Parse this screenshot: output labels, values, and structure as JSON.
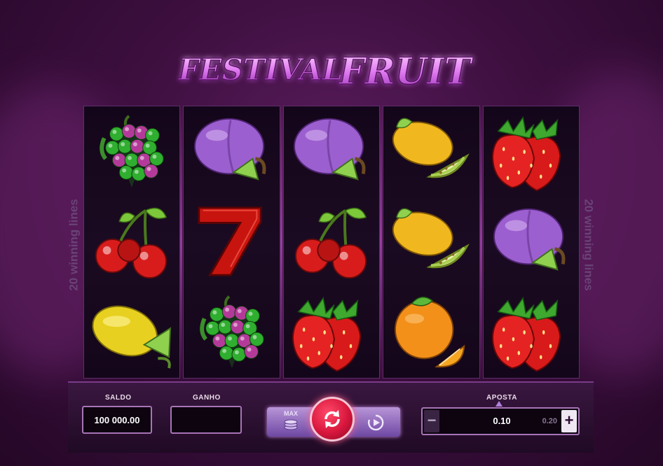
{
  "game": {
    "title_line1": "FESTIVAL",
    "title_line2": "FRUIT",
    "side_label_left": "20 winning lines",
    "side_label_right": "20 winning lines"
  },
  "reels": [
    [
      "grapes",
      "cherries",
      "lemon"
    ],
    [
      "plum",
      "seven",
      "grapes"
    ],
    [
      "plum",
      "cherries",
      "strawberry"
    ],
    [
      "melon",
      "melon",
      "orange"
    ],
    [
      "strawberry",
      "plum",
      "strawberry"
    ]
  ],
  "panel": {
    "saldo_label": "SALDO",
    "saldo_value": "100 000.00",
    "ganho_label": "GANHO",
    "ganho_value": "",
    "max_label": "MAX",
    "aposta_label": "APOSTA",
    "aposta_value": "0.10",
    "aposta_next": "0.20",
    "minus_label": "−",
    "plus_label": "+"
  },
  "colors": {
    "background": "#3d0f3f",
    "accent": "#c35ad4",
    "spin": "#d8163d"
  },
  "icons": {
    "spin": "refresh-icon",
    "autoplay": "play-circle-icon",
    "max": "coin-stack-icon"
  }
}
